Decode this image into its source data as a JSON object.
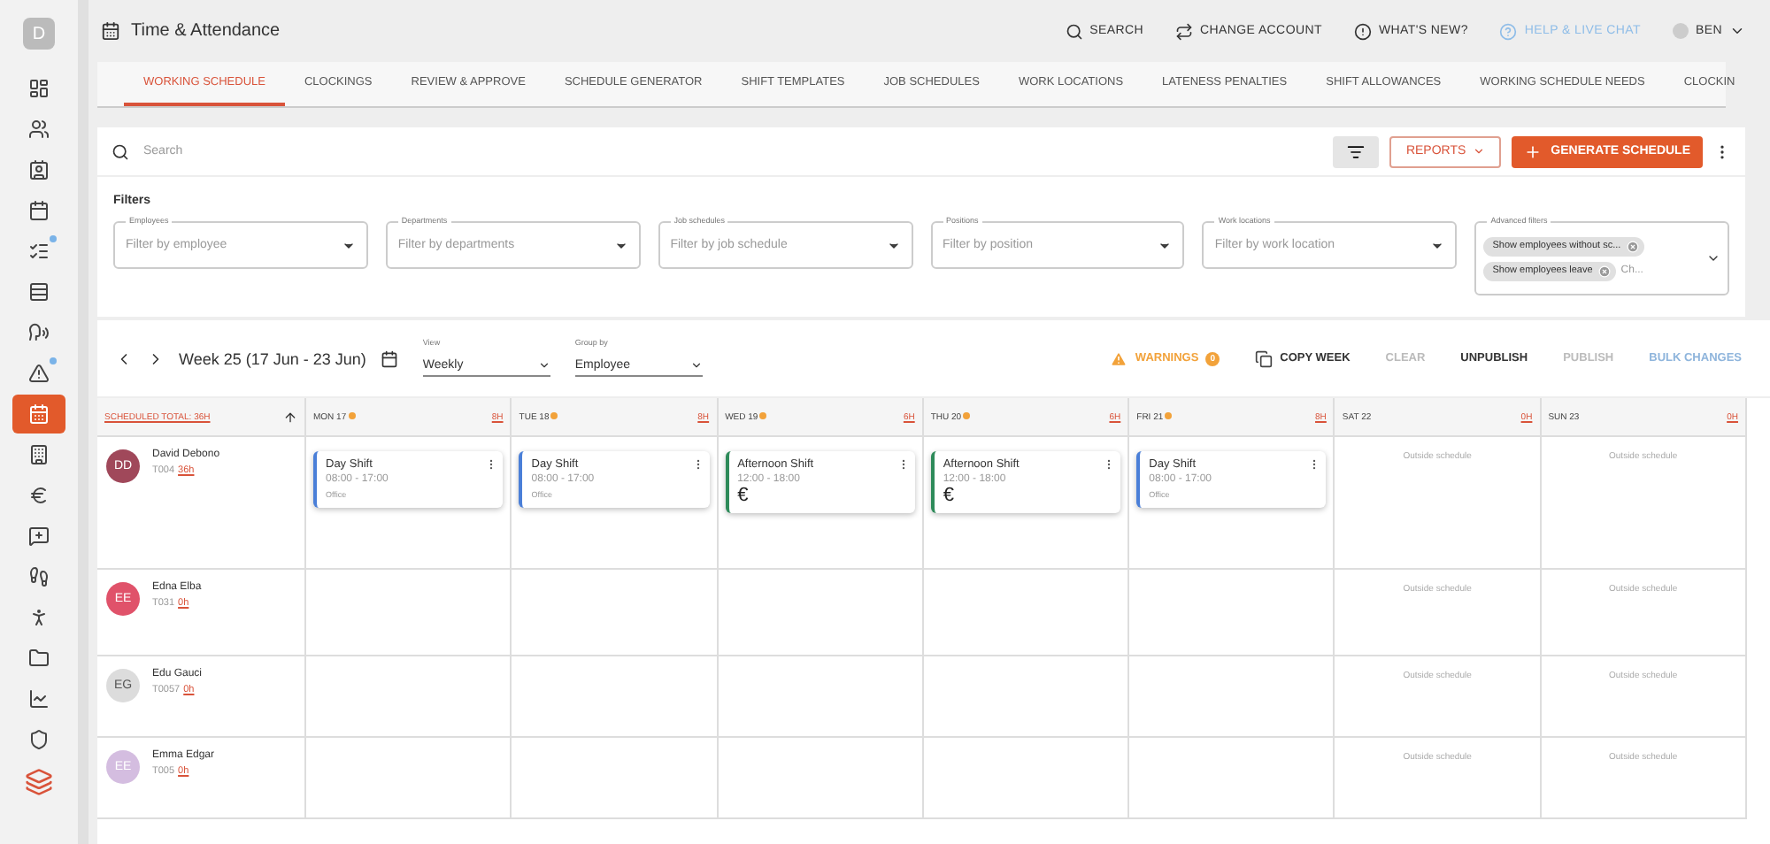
{
  "app": {
    "avatar": "D",
    "title": "Time & Attendance"
  },
  "sidebar": {
    "items": [
      {
        "selected": false,
        "dot": false
      },
      {
        "selected": false,
        "dot": false
      },
      {
        "selected": false,
        "dot": false
      },
      {
        "selected": false,
        "dot": false
      },
      {
        "selected": false,
        "dot": true
      },
      {
        "selected": false,
        "dot": false
      },
      {
        "selected": false,
        "dot": false
      },
      {
        "selected": false,
        "dot": true
      },
      {
        "selected": true,
        "dot": false
      },
      {
        "selected": false,
        "dot": false
      },
      {
        "selected": false,
        "dot": false
      },
      {
        "selected": false,
        "dot": false
      },
      {
        "selected": false,
        "dot": false
      },
      {
        "selected": false,
        "dot": false
      },
      {
        "selected": false,
        "dot": false
      },
      {
        "selected": false,
        "dot": false
      },
      {
        "selected": false,
        "dot": false
      }
    ]
  },
  "top_actions": [
    {
      "label": "SEARCH",
      "kind": "search"
    },
    {
      "label": "CHANGE ACCOUNT",
      "kind": "switch"
    },
    {
      "label": "WHAT'S NEW?",
      "kind": "news"
    },
    {
      "label": "HELP & LIVE CHAT",
      "kind": "help"
    }
  ],
  "user": {
    "name": "BEN"
  },
  "tabs": [
    {
      "label": "WORKING SCHEDULE",
      "selected": true
    },
    {
      "label": "CLOCKINGS",
      "selected": false
    },
    {
      "label": "REVIEW & APPROVE",
      "selected": false
    },
    {
      "label": "SCHEDULE GENERATOR",
      "selected": false
    },
    {
      "label": "SHIFT TEMPLATES",
      "selected": false
    },
    {
      "label": "JOB SCHEDULES",
      "selected": false
    },
    {
      "label": "WORK LOCATIONS",
      "selected": false
    },
    {
      "label": "LATENESS PENALTIES",
      "selected": false
    },
    {
      "label": "SHIFT ALLOWANCES",
      "selected": false
    },
    {
      "label": "WORKING SCHEDULE NEEDS",
      "selected": false
    },
    {
      "label": "CLOCKIN",
      "selected": false
    }
  ],
  "search": {
    "placeholder": "Search"
  },
  "toolbar": {
    "reports": "REPORTS",
    "generate": "GENERATE SCHEDULE"
  },
  "filters": {
    "title": "Filters",
    "fields": [
      {
        "label": "Employees",
        "placeholder": "Filter by employee"
      },
      {
        "label": "Departments",
        "placeholder": "Filter by departments"
      },
      {
        "label": "Job schedules",
        "placeholder": "Filter by job schedule"
      },
      {
        "label": "Positions",
        "placeholder": "Filter by position"
      },
      {
        "label": "Work locations",
        "placeholder": "Filter by work location"
      }
    ],
    "advanced": {
      "label": "Advanced filters",
      "chips": [
        "Show employees without sc...",
        "Show employees leave"
      ],
      "placeholder": "Ch..."
    }
  },
  "week": {
    "title": "Week 25 (17 Jun - 23 Jun)",
    "view": {
      "label": "View",
      "value": "Weekly"
    },
    "group_by": {
      "label": "Group by",
      "value": "Employee"
    }
  },
  "actions": [
    {
      "label": "WARNINGS",
      "kind": "warning",
      "count": "0",
      "disabled": false
    },
    {
      "label": "COPY WEEK",
      "kind": "copy",
      "disabled": false
    },
    {
      "label": "CLEAR",
      "kind": "plain",
      "disabled": true
    },
    {
      "label": "UNPUBLISH",
      "kind": "plain",
      "disabled": false
    },
    {
      "label": "PUBLISH",
      "kind": "plain",
      "disabled": true
    },
    {
      "label": "BULK CHANGES",
      "kind": "link",
      "disabled": false
    }
  ],
  "schedule": {
    "total": "SCHEDULED TOTAL: 36H",
    "days": [
      {
        "label": "MON 17",
        "hours": "8H",
        "warning": true
      },
      {
        "label": "TUE 18",
        "hours": "8H",
        "warning": true
      },
      {
        "label": "WED 19",
        "hours": "6H",
        "warning": true
      },
      {
        "label": "THU 20",
        "hours": "6H",
        "warning": true
      },
      {
        "label": "FRI 21",
        "hours": "8H",
        "warning": true
      },
      {
        "label": "SAT 22",
        "hours": "0H",
        "warning": false
      },
      {
        "label": "SUN 23",
        "hours": "0H",
        "warning": false
      }
    ],
    "employees": [
      {
        "initials": "DD",
        "color": "#a0485a",
        "name": "David Debono",
        "code": "T004",
        "hours": "36h",
        "cells": [
          {
            "kind": "shift",
            "title": "Day Shift",
            "time": "08:00 - 17:00",
            "location": "Office",
            "color": "#4a7fd8"
          },
          {
            "kind": "shift",
            "title": "Day Shift",
            "time": "08:00 - 17:00",
            "location": "Office",
            "color": "#4a7fd8"
          },
          {
            "kind": "shift",
            "title": "Afternoon Shift",
            "time": "12:00 - 18:00",
            "symbol": "€",
            "color": "#2e8b5a"
          },
          {
            "kind": "shift",
            "title": "Afternoon Shift",
            "time": "12:00 - 18:00",
            "symbol": "€",
            "color": "#2e8b5a"
          },
          {
            "kind": "shift",
            "title": "Day Shift",
            "time": "08:00 - 17:00",
            "location": "Office",
            "color": "#4a7fd8"
          },
          {
            "kind": "note",
            "text": "Outside schedule"
          },
          {
            "kind": "note",
            "text": "Outside schedule"
          }
        ]
      },
      {
        "initials": "EE",
        "color": "#e0526a",
        "name": "Edna Elba",
        "code": "T031",
        "hours": "0h",
        "cells": [
          {
            "kind": "empty"
          },
          {
            "kind": "empty"
          },
          {
            "kind": "empty"
          },
          {
            "kind": "empty"
          },
          {
            "kind": "empty"
          },
          {
            "kind": "note",
            "text": "Outside schedule"
          },
          {
            "kind": "note",
            "text": "Outside schedule"
          }
        ]
      },
      {
        "initials": "EG",
        "color": "#dcdcdc",
        "name": "Edu Gauci",
        "code": "T0057",
        "hours": "0h",
        "cells": [
          {
            "kind": "empty"
          },
          {
            "kind": "empty"
          },
          {
            "kind": "empty"
          },
          {
            "kind": "empty"
          },
          {
            "kind": "empty"
          },
          {
            "kind": "note",
            "text": "Outside schedule"
          },
          {
            "kind": "note",
            "text": "Outside schedule"
          }
        ]
      },
      {
        "initials": "EE",
        "color": "#d4bde0",
        "name": "Emma Edgar",
        "code": "T005",
        "hours": "0h",
        "cells": [
          {
            "kind": "empty"
          },
          {
            "kind": "empty"
          },
          {
            "kind": "empty"
          },
          {
            "kind": "empty"
          },
          {
            "kind": "empty"
          },
          {
            "kind": "note",
            "text": "Outside schedule"
          },
          {
            "kind": "note",
            "text": "Outside schedule"
          }
        ]
      }
    ]
  }
}
